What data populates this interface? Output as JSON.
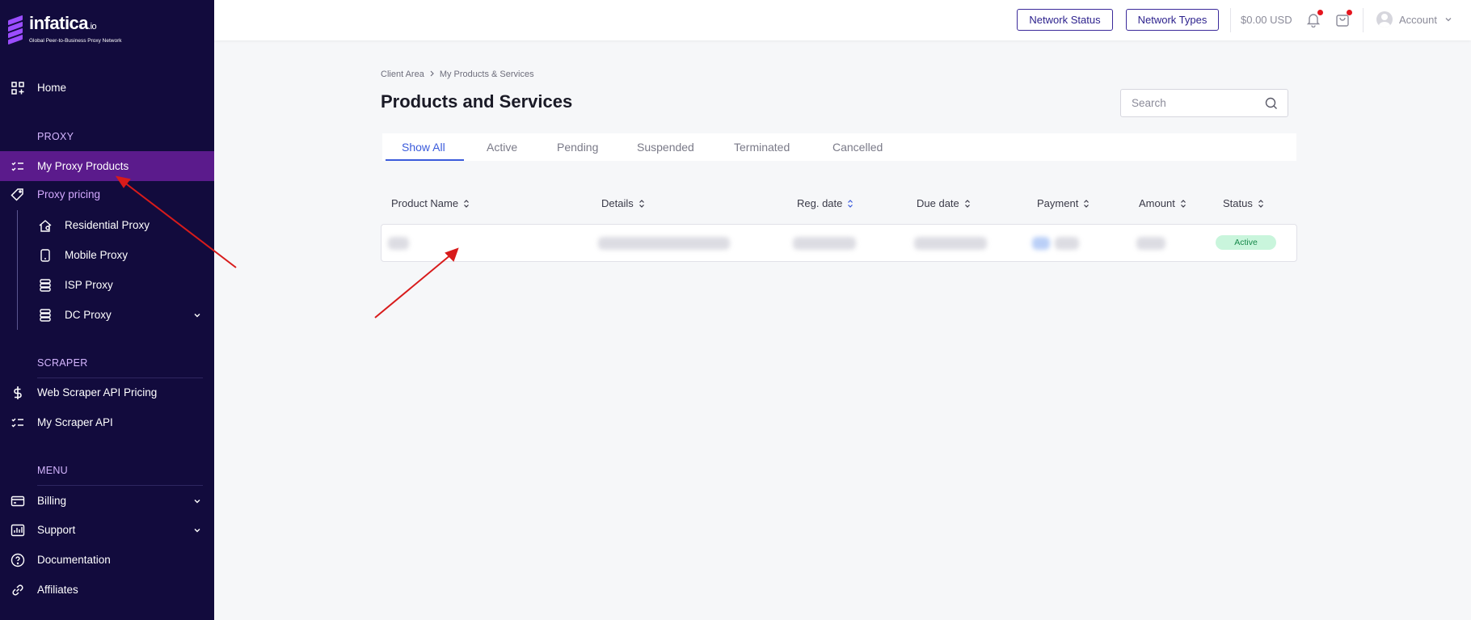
{
  "brand": {
    "name": "infatica",
    "suffix": ".io",
    "tagline": "Global Peer-to-Business Proxy Network",
    "accent": "#9b4dff"
  },
  "sidebar": {
    "home": "Home",
    "proxy_section": "PROXY",
    "my_proxy_products": "My Proxy Products",
    "proxy_pricing": "Proxy pricing",
    "sub_items": [
      "Residential Proxy",
      "Mobile Proxy",
      "ISP Proxy",
      "DC Proxy"
    ],
    "scraper_section": "SCRAPER",
    "web_scraper_pricing": "Web Scraper API Pricing",
    "my_scraper_api": "My Scraper API",
    "menu_section": "MENU",
    "billing": "Billing",
    "support": "Support",
    "documentation": "Documentation",
    "affiliates": "Affiliates"
  },
  "topbar": {
    "network_status": "Network Status",
    "network_types": "Network Types",
    "balance": "$0.00 USD",
    "account": "Account"
  },
  "breadcrumb": [
    "Client Area",
    "My Products & Services"
  ],
  "page_title": "Products and Services",
  "search": {
    "placeholder": "Search"
  },
  "tabs": [
    "Show All",
    "Active",
    "Pending",
    "Suspended",
    "Terminated",
    "Cancelled"
  ],
  "active_tab": "Show All",
  "table": {
    "columns": [
      "Product Name",
      "Details",
      "Reg. date",
      "Due date",
      "Payment",
      "Amount",
      "Status"
    ],
    "rows": [
      {
        "status": "Active"
      }
    ]
  },
  "colors": {
    "sidebar_bg": "#120b3d",
    "active_item": "#5b1b8c",
    "tab_active": "#3b5bdb",
    "annotation_arrow": "#d81b1b",
    "status_active_bg": "#c9f5dc"
  }
}
